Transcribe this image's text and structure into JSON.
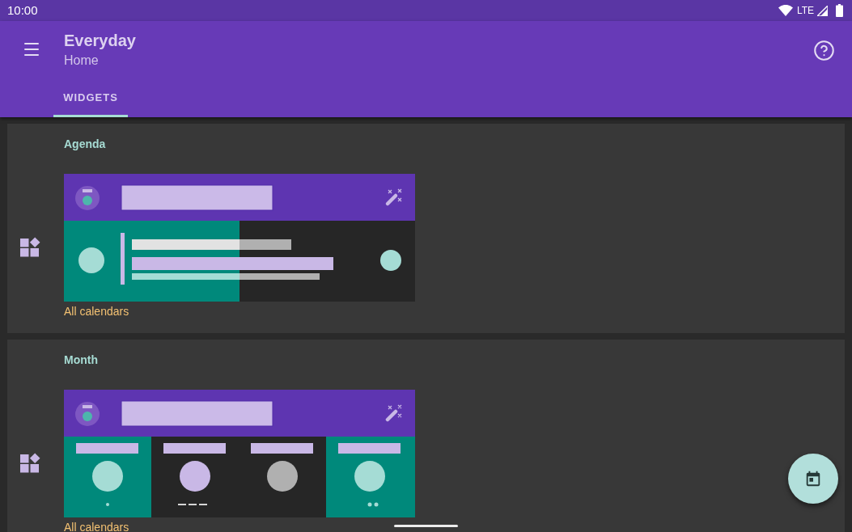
{
  "status_bar": {
    "time": "10:00",
    "network": "LTE"
  },
  "app_bar": {
    "title": "Everyday",
    "subtitle": "Home"
  },
  "tabs": [
    {
      "label": "WIDGETS",
      "selected": true
    }
  ],
  "widgets": [
    {
      "kind": "agenda",
      "title": "Agenda",
      "calendars": "All calendars"
    },
    {
      "kind": "month",
      "title": "Month",
      "calendars": "All calendars"
    }
  ]
}
